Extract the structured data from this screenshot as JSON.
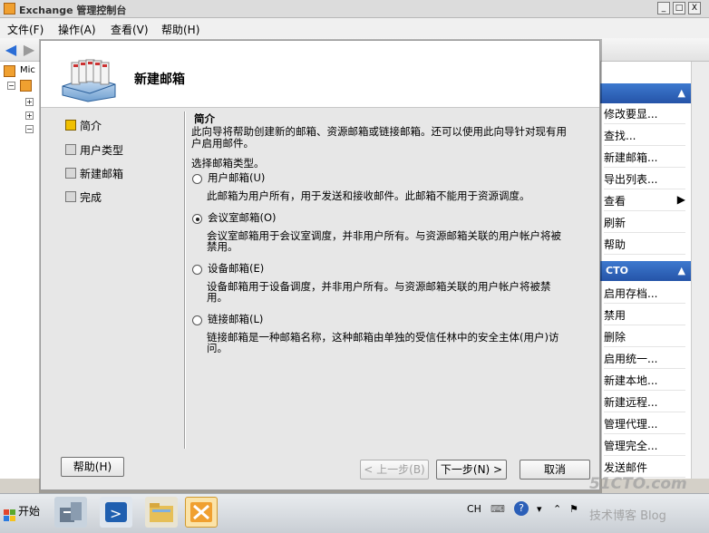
{
  "window": {
    "title": "Exchange 管理控制台",
    "min": "_",
    "max": "□",
    "close": "X"
  },
  "menu": [
    "文件(F)",
    "操作(A)",
    "查看(V)",
    "帮助(H)"
  ],
  "tree": {
    "root_label": "Mic"
  },
  "actions": {
    "group1": [
      {
        "label": "修改要显..."
      },
      {
        "label": "查找..."
      },
      {
        "label": "新建邮箱..."
      },
      {
        "label": "导出列表..."
      },
      {
        "label": "查看"
      },
      {
        "label": "刷新"
      },
      {
        "label": "帮助"
      }
    ],
    "group2_title": "CTO",
    "group2": [
      {
        "label": "启用存档..."
      },
      {
        "label": "禁用"
      },
      {
        "label": "删除"
      },
      {
        "label": "启用统一..."
      },
      {
        "label": "新建本地..."
      },
      {
        "label": "新建远程..."
      },
      {
        "label": "管理代理..."
      },
      {
        "label": "管理完全..."
      },
      {
        "label": "发送邮件"
      }
    ]
  },
  "wizard": {
    "title": "新建邮箱",
    "steps": [
      "简介",
      "用户类型",
      "新建邮箱",
      "完成"
    ],
    "active_step": 0,
    "section_title": "简介",
    "intro": [
      "此向导将帮助创建新的邮箱、资源邮箱或链接邮箱。还可以使用此向导针对现有用",
      "户启用邮件。"
    ],
    "choose_label": "选择邮箱类型。",
    "options": [
      {
        "label": "用户邮箱(U)",
        "selected": false,
        "desc": [
          "此邮箱为用户所有，用于发送和接收邮件。此邮箱不能用于资源调度。"
        ]
      },
      {
        "label": "会议室邮箱(O)",
        "selected": true,
        "desc": [
          "会议室邮箱用于会议室调度，并非用户所有。与资源邮箱关联的用户帐户将被",
          "禁用。"
        ]
      },
      {
        "label": "设备邮箱(E)",
        "selected": false,
        "desc": [
          "设备邮箱用于设备调度，并非用户所有。与资源邮箱关联的用户帐户将被禁",
          "用。"
        ]
      },
      {
        "label": "链接邮箱(L)",
        "selected": false,
        "desc": [
          "链接邮箱是一种邮箱名称，这种邮箱由单独的受信任林中的安全主体(用户)访",
          "问。"
        ]
      }
    ],
    "buttons": {
      "help": "帮助(H)",
      "back": "< 上一步(B)",
      "next": "下一步(N) >",
      "cancel": "取消"
    }
  },
  "taskbar": {
    "start": "开始",
    "lang": "CH"
  },
  "watermark": {
    "line1": "51CTO.com",
    "line2": "技术博客  Blog"
  }
}
